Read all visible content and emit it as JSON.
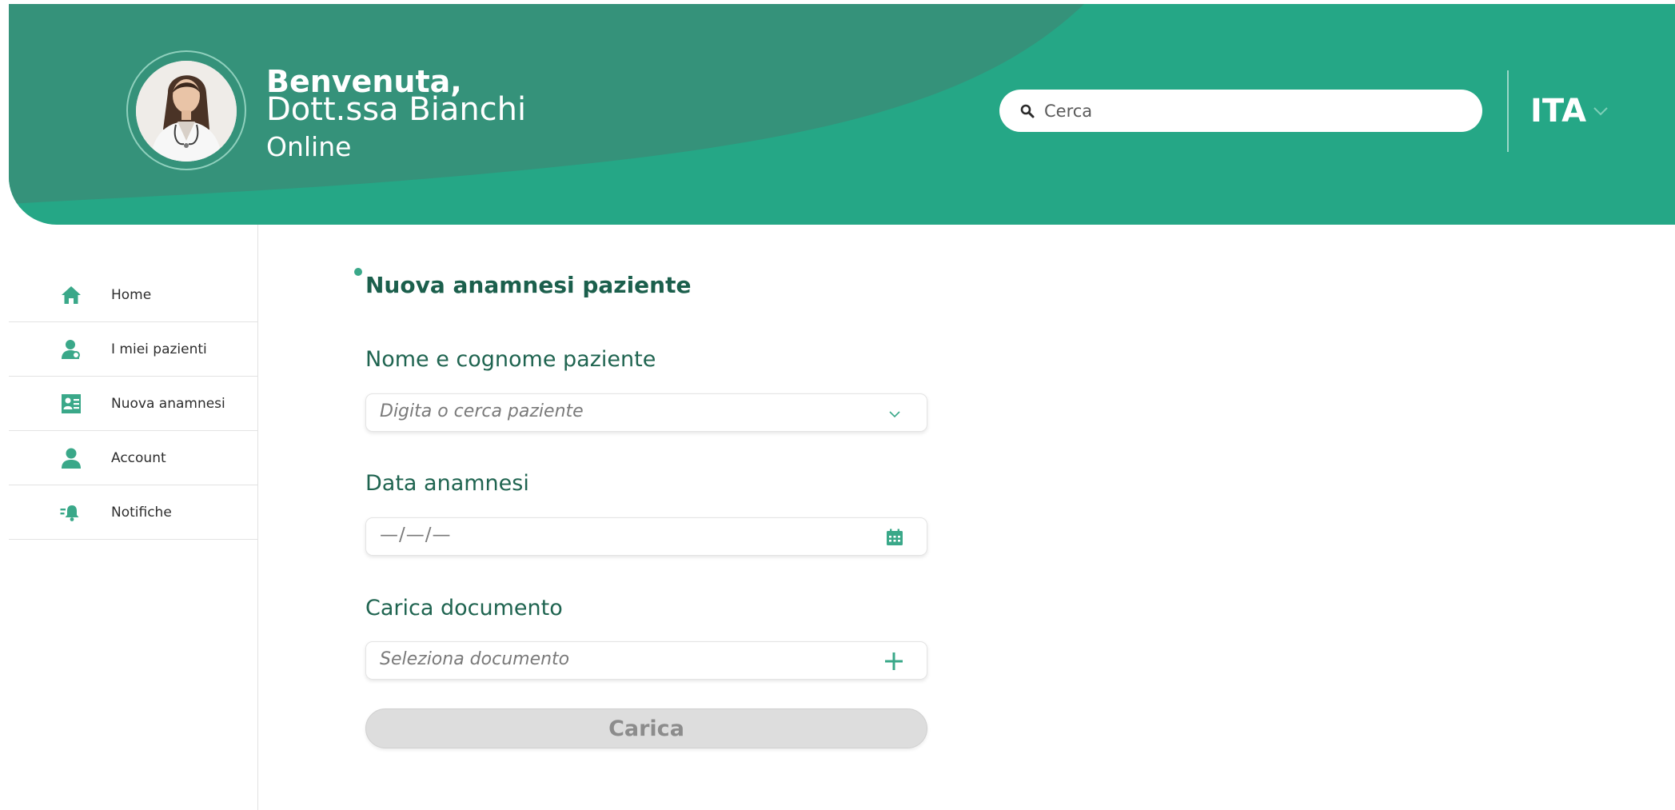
{
  "header": {
    "greeting": "Benvenuta,",
    "doctor_name": "Dott.ssa Bianchi",
    "status": "Online",
    "search_placeholder": "Cerca",
    "language": "ITA"
  },
  "sidebar": {
    "items": [
      {
        "label": "Home",
        "icon": "home-icon"
      },
      {
        "label": "I miei pazienti",
        "icon": "patients-icon"
      },
      {
        "label": "Nuova anamnesi",
        "icon": "new-anamnesis-icon"
      },
      {
        "label": "Account",
        "icon": "account-icon"
      },
      {
        "label": "Notifiche",
        "icon": "notifications-icon"
      }
    ]
  },
  "form": {
    "title": "Nuova anamnesi paziente",
    "patient_label": "Nome e cognome paziente",
    "patient_placeholder": "Digita o cerca paziente",
    "date_label": "Data anamnesi",
    "date_value": "—/—/—",
    "document_label": "Carica documento",
    "document_placeholder": "Seleziona documento",
    "submit_label": "Carica"
  },
  "colors": {
    "primary": "#25a786",
    "primary_dark": "#35927a",
    "text_dark_green": "#1b5f4c",
    "disabled_button": "#dddddd"
  }
}
